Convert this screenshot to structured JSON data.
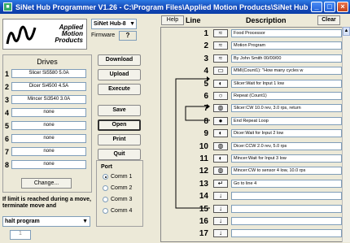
{
  "window": {
    "title": "SiNet Hub Programmer  V1.26 - C:\\Program Files\\Applied Motion Products\\SiNet Hub ...",
    "min": "_",
    "max": "□",
    "close": "×"
  },
  "logo": {
    "line1": "Applied",
    "line2": "Motion",
    "line3": "Products"
  },
  "hub": {
    "selected": "SiNet Hub-8",
    "firmware_label": "Firmware",
    "firmware_value": "?"
  },
  "drives": {
    "header": "Drives",
    "items": [
      {
        "num": "1",
        "value": "Slicer Si5580 5.0A"
      },
      {
        "num": "2",
        "value": "Dicer Si4500 4.5A"
      },
      {
        "num": "3",
        "value": "Mincer Si3540 3.0A"
      },
      {
        "num": "4",
        "value": "none"
      },
      {
        "num": "5",
        "value": "none"
      },
      {
        "num": "6",
        "value": "none"
      },
      {
        "num": "7",
        "value": "none"
      },
      {
        "num": "8",
        "value": "none"
      }
    ],
    "change_label": "Change..."
  },
  "buttons": {
    "download": "Download",
    "upload": "Upload",
    "execute": "Execute",
    "save": "Save",
    "open": "Open",
    "print": "Print",
    "quit": "Quit"
  },
  "port": {
    "label": "Port",
    "options": [
      "Comm 1",
      "Comm 2",
      "Comm 3",
      "Comm 4"
    ],
    "selected_index": 0
  },
  "limit": {
    "text": "If limit is reached during a move, terminate move and",
    "selected": "halt program",
    "field_value": "1"
  },
  "program": {
    "help_label": "Help",
    "line_header": "Line",
    "desc_header": "Description",
    "clear_label": "Clear",
    "lines": [
      {
        "num": "1",
        "icon": "motor-icon",
        "desc": "Food Processor"
      },
      {
        "num": "2",
        "icon": "motor-icon",
        "desc": "Motion Program"
      },
      {
        "num": "3",
        "icon": "motor-icon",
        "desc": "By John Smith 00/00/00"
      },
      {
        "num": "4",
        "icon": "message-icon",
        "desc": "MMI(Count1): \"How many cycles   w"
      },
      {
        "num": "5",
        "icon": "wait-input-icon",
        "desc": "Slicer:Wait for Input 1 low"
      },
      {
        "num": "6",
        "icon": "repeat-icon",
        "desc": "Repeat (Count1)"
      },
      {
        "num": "7",
        "icon": "move-icon",
        "desc": "Slicer:CW 10.0 rev, 3.0 rps, return"
      },
      {
        "num": "8",
        "icon": "end-repeat-icon",
        "desc": "End Repeat Loop"
      },
      {
        "num": "9",
        "icon": "wait-input-icon",
        "desc": "Dicer:Wait for Input 2 low"
      },
      {
        "num": "10",
        "icon": "move-icon",
        "desc": "Dicer:CCW 2.0 rev, 5.0 rps"
      },
      {
        "num": "11",
        "icon": "wait-input-icon",
        "desc": "Mincer:Wait for Input 3 low"
      },
      {
        "num": "12",
        "icon": "move-icon",
        "desc": "Mincer:CW to sensor 4 low, 10.0 rps"
      },
      {
        "num": "13",
        "icon": "goto-icon",
        "desc": "Go to line 4"
      },
      {
        "num": "14",
        "icon": "empty-icon",
        "desc": ""
      },
      {
        "num": "15",
        "icon": "empty-icon",
        "desc": ""
      },
      {
        "num": "16",
        "icon": "empty-icon",
        "desc": ""
      },
      {
        "num": "17",
        "icon": "empty-icon",
        "desc": ""
      }
    ]
  },
  "colors": {
    "titlebar": "#1549b8",
    "window_bg": "#ece9d8",
    "field_border": "#7f9db9"
  }
}
